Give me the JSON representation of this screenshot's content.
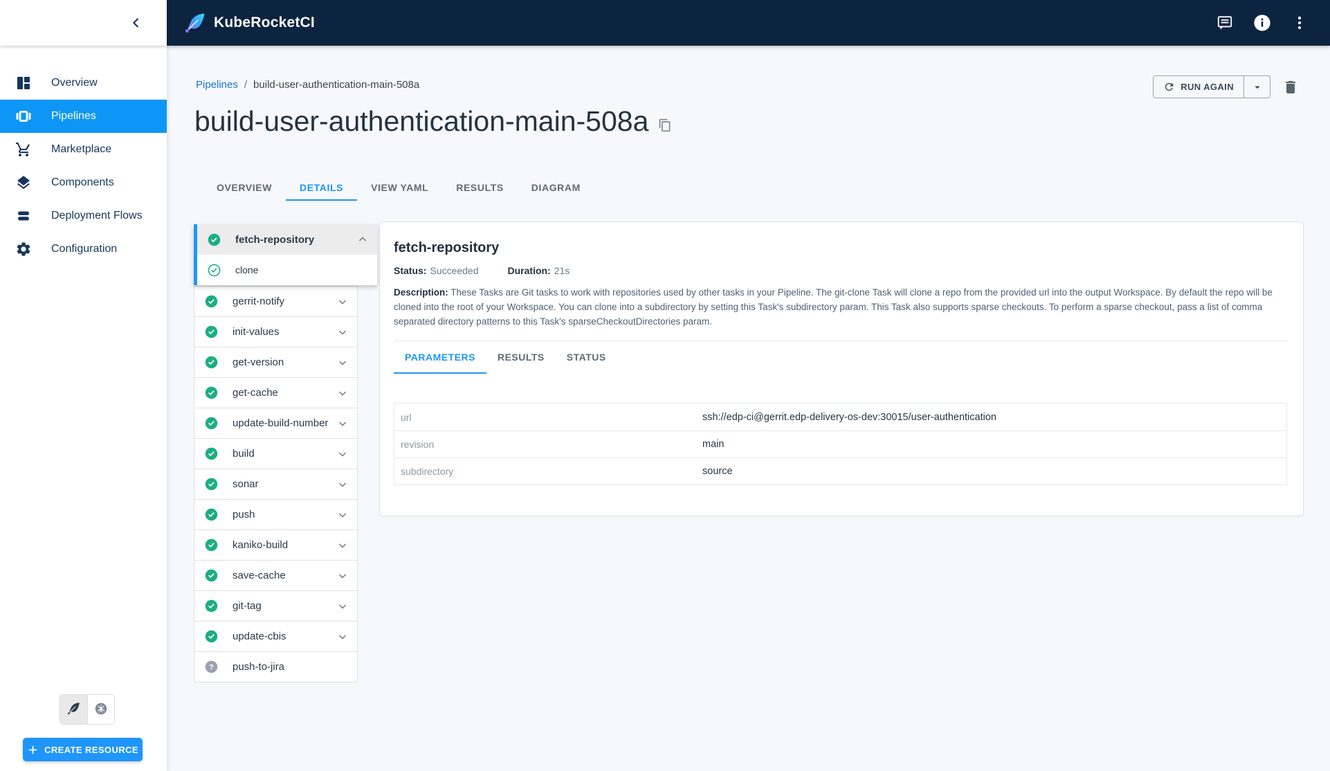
{
  "header": {
    "app_title": "KubeRocketCI",
    "icons": [
      {
        "name": "feedback-icon"
      },
      {
        "name": "info-icon"
      },
      {
        "name": "kebab-menu-icon"
      }
    ]
  },
  "sidebar": {
    "items": [
      {
        "label": "Overview",
        "icon": "dashboard",
        "active": false
      },
      {
        "label": "Pipelines",
        "icon": "pipelines",
        "active": true
      },
      {
        "label": "Marketplace",
        "icon": "cart",
        "active": false
      },
      {
        "label": "Components",
        "icon": "layers",
        "active": false
      },
      {
        "label": "Deployment Flows",
        "icon": "flows",
        "active": false
      },
      {
        "label": "Configuration",
        "icon": "gear",
        "active": false
      }
    ],
    "cluster_toggle": [
      {
        "icon": "feather",
        "selected": true
      },
      {
        "icon": "kubernetes",
        "selected": false
      }
    ],
    "create_button_label": "CREATE RESOURCE"
  },
  "breadcrumb": {
    "parent": "Pipelines",
    "separator": "/",
    "current": "build-user-authentication-main-508a"
  },
  "page": {
    "title": "build-user-authentication-main-508a",
    "run_again_label": "RUN AGAIN"
  },
  "tabs": [
    {
      "label": "OVERVIEW",
      "active": false
    },
    {
      "label": "DETAILS",
      "active": true
    },
    {
      "label": "VIEW YAML",
      "active": false
    },
    {
      "label": "RESULTS",
      "active": false
    },
    {
      "label": "DIAGRAM",
      "active": false
    }
  ],
  "tasks": [
    {
      "label": "fetch-repository",
      "status": "succeeded",
      "expanded": true,
      "selected": true,
      "children": [
        {
          "label": "clone",
          "status": "succeeded"
        }
      ]
    },
    {
      "label": "gerrit-notify",
      "status": "succeeded"
    },
    {
      "label": "init-values",
      "status": "succeeded"
    },
    {
      "label": "get-version",
      "status": "succeeded"
    },
    {
      "label": "get-cache",
      "status": "succeeded"
    },
    {
      "label": "update-build-number",
      "status": "succeeded"
    },
    {
      "label": "build",
      "status": "succeeded"
    },
    {
      "label": "sonar",
      "status": "succeeded"
    },
    {
      "label": "push",
      "status": "succeeded"
    },
    {
      "label": "kaniko-build",
      "status": "succeeded"
    },
    {
      "label": "save-cache",
      "status": "succeeded"
    },
    {
      "label": "git-tag",
      "status": "succeeded"
    },
    {
      "label": "update-cbis",
      "status": "succeeded"
    },
    {
      "label": "push-to-jira",
      "status": "unknown"
    }
  ],
  "task_detail": {
    "title": "fetch-repository",
    "status_label": "Status:",
    "status_value": "Succeeded",
    "duration_label": "Duration:",
    "duration_value": "21s",
    "description_label": "Description:",
    "description": "These Tasks are Git tasks to work with repositories used by other tasks in your Pipeline. The git-clone Task will clone a repo from the provided url into the output Workspace. By default the repo will be cloned into the root of your Workspace. You can clone into a subdirectory by setting this Task's subdirectory param. This Task also supports sparse checkouts. To perform a sparse checkout, pass a list of comma separated directory patterns to this Task's sparseCheckoutDirectories param.",
    "subtabs": [
      {
        "label": "PARAMETERS",
        "active": true
      },
      {
        "label": "RESULTS",
        "active": false
      },
      {
        "label": "STATUS",
        "active": false
      }
    ],
    "parameters": [
      {
        "key": "url",
        "value": "ssh://edp-ci@gerrit.edp-delivery-os-dev:30015/user-authentication"
      },
      {
        "key": "revision",
        "value": "main"
      },
      {
        "key": "subdirectory",
        "value": "source"
      }
    ]
  },
  "colors": {
    "accent": "#1e96fc",
    "header_bg": "#0d2440",
    "sidebar_active_bg": "#0d96f5",
    "success_green": "#1cae83",
    "unknown_gray": "#99a1ad",
    "selected_task_border": "#2196f3"
  }
}
